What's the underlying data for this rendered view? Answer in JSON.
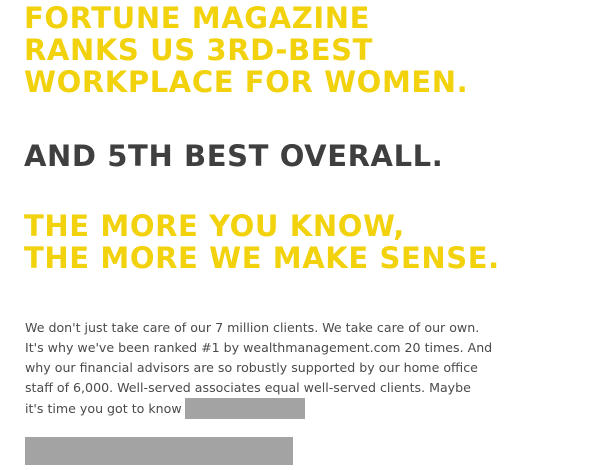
{
  "headline_1": {
    "lines": [
      "FORTUNE MAGAZINE",
      "RANKS US 3RD-BEST",
      "WORKPLACE FOR WOMEN."
    ]
  },
  "headline_2": {
    "text": "AND 5TH BEST OVERALL."
  },
  "headline_3": {
    "lines": [
      "THE MORE YOU KNOW,",
      "THE MORE WE MAKE SENSE."
    ]
  },
  "body": {
    "lines": [
      "We don't just take care of our 7 million clients. We take care of our own.",
      "It's why we've been ranked #1 by wealthmanagement.com 20 times. And",
      "why our financial advisors are so robustly supported by our home office",
      "staff of 6,000. Well-served associates equal well-served clients. Maybe",
      "it's time you got to know"
    ]
  },
  "colors": {
    "accent_yellow": "#f1d20c",
    "headline_gray": "#3f3f3f",
    "body_text": "#4a4a4a",
    "redaction": "#a3a3a3"
  }
}
